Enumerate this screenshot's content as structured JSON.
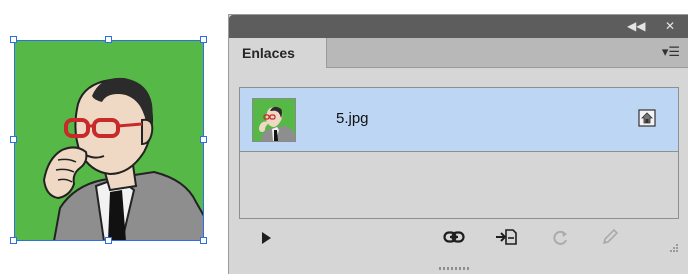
{
  "panel": {
    "tab_label": "Enlaces",
    "collapse_icon": "double-chevron-left-icon",
    "close_icon": "close-icon",
    "menu_icon": "panel-menu-icon"
  },
  "links": [
    {
      "filename": "5.jpg",
      "status_icon": "embedded-icon",
      "selected": true
    }
  ],
  "footer": {
    "icons": [
      "show-link-info-icon",
      "relink-icon",
      "go-to-link-icon",
      "update-link-icon",
      "edit-original-icon"
    ]
  },
  "colors": {
    "selection_blue": "#2f6fe6",
    "row_selected": "#bcd6f4",
    "panel_bg": "#d6d6d6",
    "art_green": "#56b846"
  }
}
